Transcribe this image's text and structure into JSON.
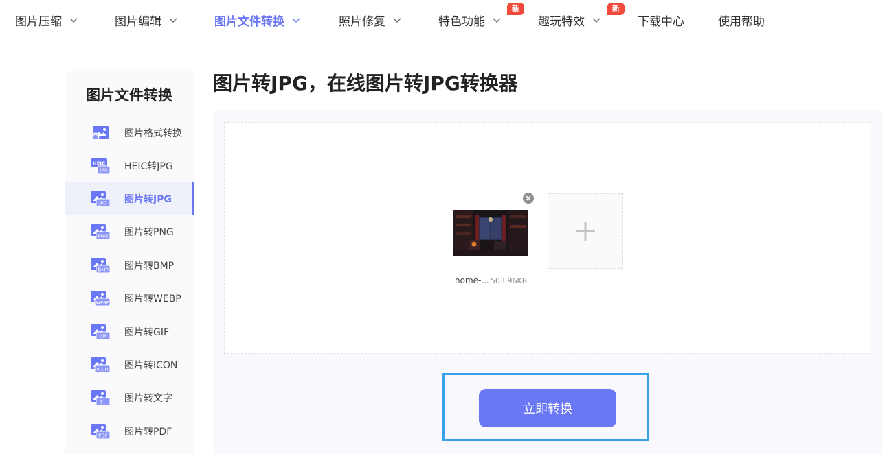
{
  "nav": {
    "items": [
      {
        "label": "图片压缩",
        "dropdown": true
      },
      {
        "label": "图片编辑",
        "dropdown": true
      },
      {
        "label": "图片文件转换",
        "dropdown": true,
        "active": true
      },
      {
        "label": "照片修复",
        "dropdown": true
      },
      {
        "label": "特色功能",
        "dropdown": true,
        "badge": "新"
      },
      {
        "label": "趣玩特效",
        "dropdown": true,
        "badge": "新"
      },
      {
        "label": "下载中心",
        "dropdown": false
      },
      {
        "label": "使用帮助",
        "dropdown": false
      }
    ]
  },
  "sidebar": {
    "title": "图片文件转换",
    "items": [
      {
        "label": "图片格式转换",
        "icon": "image-convert-icon",
        "tag": ""
      },
      {
        "label": "HEIC转JPG",
        "icon": "heic-jpg-icon",
        "tag": "JPG"
      },
      {
        "label": "图片转JPG",
        "icon": "jpg-icon",
        "tag": "JPG",
        "active": true
      },
      {
        "label": "图片转PNG",
        "icon": "png-icon",
        "tag": "PNG"
      },
      {
        "label": "图片转BMP",
        "icon": "bmp-icon",
        "tag": "BMP"
      },
      {
        "label": "图片转WEBP",
        "icon": "webp-icon",
        "tag": "WEBP"
      },
      {
        "label": "图片转GIF",
        "icon": "gif-icon",
        "tag": "GIF"
      },
      {
        "label": "图片转ICON",
        "icon": "icon-format-icon",
        "tag": "ICON"
      },
      {
        "label": "图片转文字",
        "icon": "text-icon",
        "tag": "T..."
      },
      {
        "label": "图片转PDF",
        "icon": "pdf-icon",
        "tag": "PDF"
      }
    ]
  },
  "main": {
    "title": "图片转JPG，在线图片转JPG转换器",
    "file": {
      "name": "home-...",
      "size": "503.96KB"
    },
    "convert_label": "立即转换"
  },
  "colors": {
    "accent": "#6b78f5",
    "badge": "#f04a3c",
    "highlight": "#3aa1ec"
  }
}
